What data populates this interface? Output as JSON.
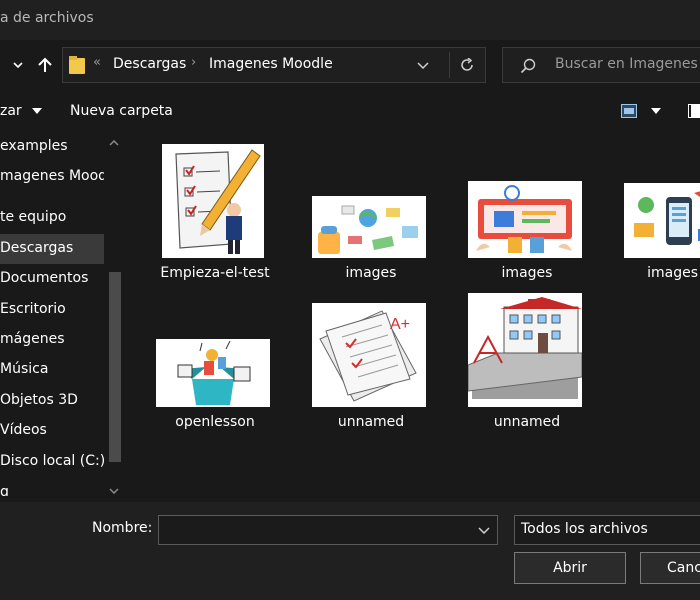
{
  "window": {
    "title": "a de archivos"
  },
  "address": {
    "overflow_marker": "«",
    "segments": [
      "Descargas",
      "Imagenes Moodle"
    ],
    "separator": "›"
  },
  "search": {
    "placeholder": "Buscar en Imagenes M"
  },
  "toolbar": {
    "organize_label": "zar",
    "new_folder_label": "Nueva carpeta"
  },
  "nav": {
    "items": [
      {
        "label": "examples"
      },
      {
        "label": "magenes Mood"
      },
      {
        "label": "te equipo"
      },
      {
        "label": "Descargas",
        "selected": true
      },
      {
        "label": "Documentos"
      },
      {
        "label": "Escritorio"
      },
      {
        "label": "mágenes"
      },
      {
        "label": "Música"
      },
      {
        "label": "Objetos 3D"
      },
      {
        "label": "Vídeos"
      },
      {
        "label": "Disco local (C:)"
      },
      {
        "label": "d"
      }
    ]
  },
  "files": [
    {
      "name": "Empieza-el-test",
      "icon": "checklist-pencil-image"
    },
    {
      "name": "images",
      "icon": "education-illustration-image"
    },
    {
      "name": "images",
      "icon": "online-learning-image"
    },
    {
      "name": "images",
      "icon": "mobile-learning-image"
    },
    {
      "name": "openlesson",
      "icon": "open-box-image"
    },
    {
      "name": "unnamed",
      "icon": "graded-exam-image"
    },
    {
      "name": "unnamed",
      "icon": "school-building-image"
    }
  ],
  "bottom": {
    "name_label": "Nombre:",
    "name_value": "",
    "filter_value": "Todos los archivos",
    "open_label": "Abrir",
    "cancel_label": "Canc"
  },
  "colors": {
    "background": "#191919",
    "selected": "#3a3a3a",
    "folder": "#f2c94c"
  }
}
